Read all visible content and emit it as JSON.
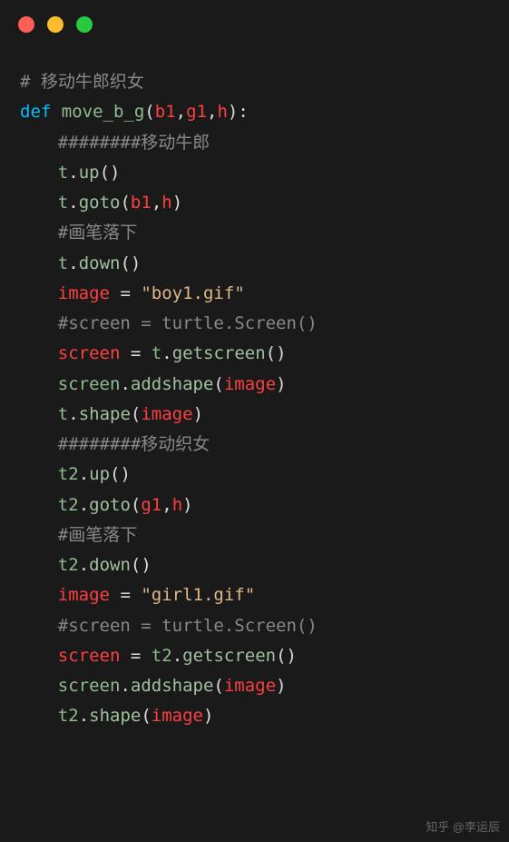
{
  "code": {
    "c1": "# 移动牛郎织女",
    "kw_def": "def",
    "fn": "move_b_g",
    "p1": "b1",
    "p2": "g1",
    "p3": "h",
    "c2": "########移动牛郎",
    "t": "t",
    "up": "up",
    "goto": "goto",
    "b1": "b1",
    "h": "h",
    "c3": "#画笔落下",
    "down": "down",
    "image": "image",
    "eq": "=",
    "str_boy": "\"boy1.gif\"",
    "c4": "#screen = turtle.Screen()",
    "screen": "screen",
    "getscreen": "getscreen",
    "addshape": "addshape",
    "shape": "shape",
    "c5": "########移动织女",
    "t2": "t2",
    "g1": "g1",
    "c6": "#画笔落下",
    "str_girl": "\"girl1.gif\"",
    "c7": "#screen = turtle.Screen()"
  },
  "watermark": "知乎 @李运辰"
}
